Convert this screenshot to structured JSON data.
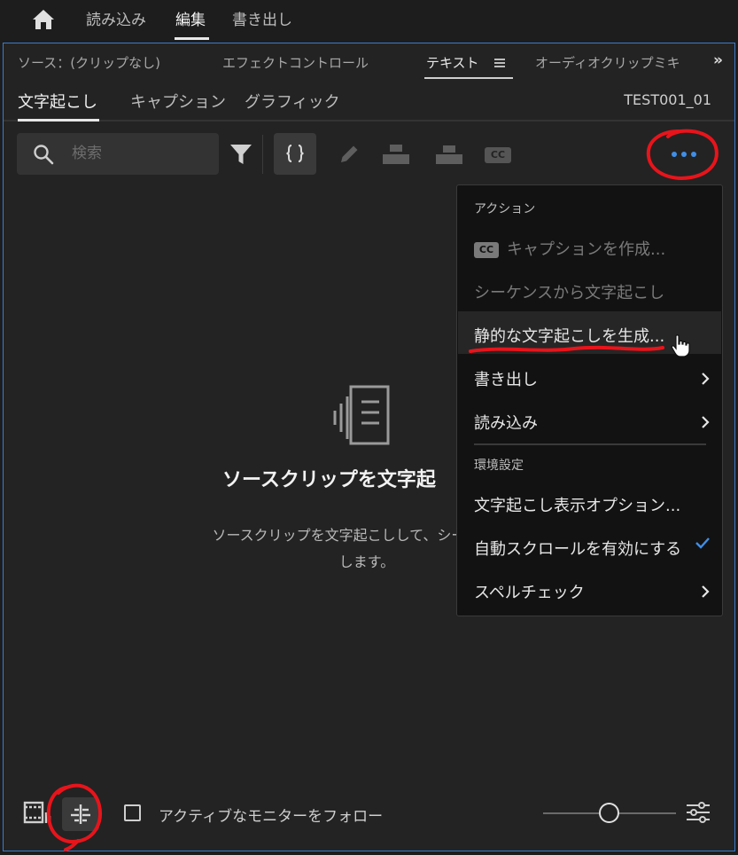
{
  "header": {
    "workspaces": [
      "読み込み",
      "編集",
      "書き出し"
    ],
    "active_workspace": "編集"
  },
  "panel_tabs": {
    "source": "ソース：(クリップなし)",
    "effect_controls": "エフェクトコントロール",
    "text": "テキスト",
    "audio_clip_mixer": "オーディオクリップミキ",
    "overflow": "»"
  },
  "sub_tabs": {
    "transcript": "文字起こし",
    "captions": "キャプション",
    "graphics": "グラフィック",
    "sequence_name": "TEST001_01"
  },
  "toolbar": {
    "search_placeholder": "検索",
    "cc_label": "CC"
  },
  "empty_state": {
    "title": "ソースクリップを文字起",
    "description_line1": "ソースクリップを文字起こしして、シーケンスの",
    "description_line2": "します。"
  },
  "bottom_bar": {
    "follow_monitor_label": "アクティブなモニターをフォロー",
    "follow_monitor_checked": false
  },
  "menu": {
    "section_actions": "アクション",
    "create_captions": "キャプションを作成...",
    "transcribe_sequence": "シーケンスから文字起こし",
    "generate_static_transcript": "静的な文字起こしを生成...",
    "export": "書き出し",
    "import": "読み込み",
    "section_preferences": "環境設定",
    "transcript_view_options": "文字起こし表示オプション...",
    "enable_autoscroll": "自動スクロールを有効にする",
    "spell_check": "スペルチェック",
    "cc_label": "CC"
  },
  "colors": {
    "accent_blue": "#3f8fe8",
    "annotation_red": "#e8141b",
    "panel_border": "#3d7cc9"
  }
}
